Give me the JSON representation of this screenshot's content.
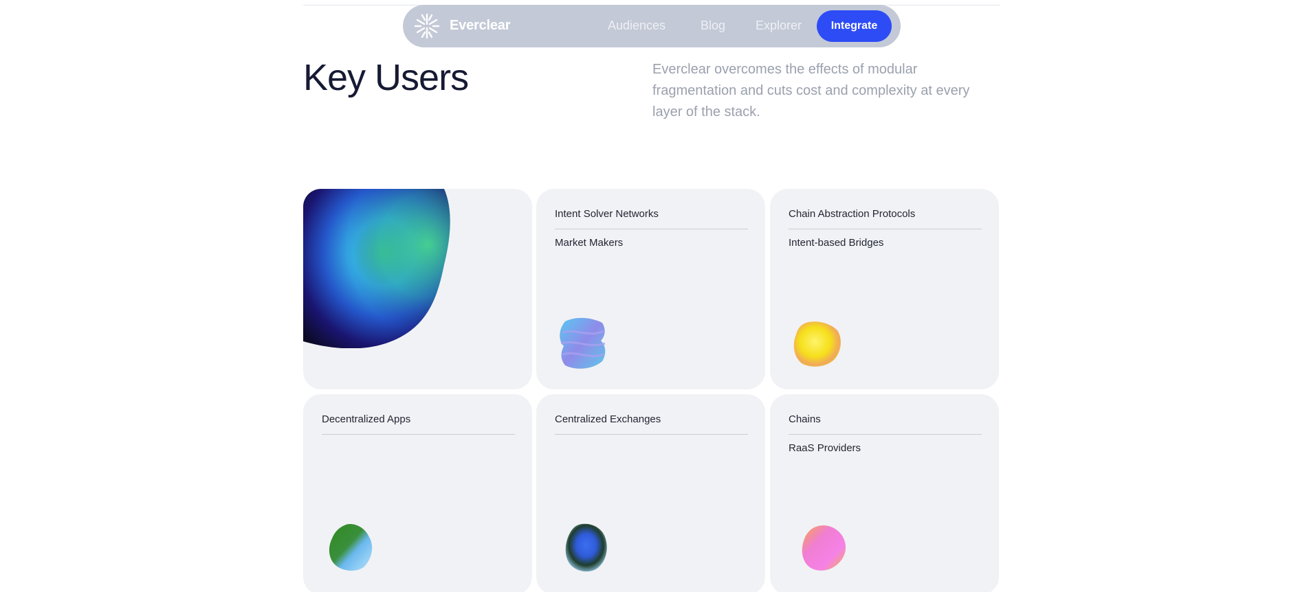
{
  "nav": {
    "brand": "Everclear",
    "links": [
      "Audiences",
      "Blog",
      "Explorer"
    ],
    "cta": "Integrate"
  },
  "hero": {
    "title": "Key Users",
    "description": "Everclear overcomes the effects of modular fragmentation and cuts cost and complexity at every layer of the stack."
  },
  "cards": [
    {
      "items": []
    },
    {
      "items": [
        "Intent Solver Networks",
        "Market Makers"
      ]
    },
    {
      "items": [
        "Chain Abstraction Protocols",
        "Intent-based Bridges"
      ]
    },
    {
      "items": [
        "Decentralized Apps"
      ]
    },
    {
      "items": [
        "Centralized Exchanges"
      ]
    },
    {
      "items": [
        "Chains",
        "RaaS Providers"
      ]
    }
  ],
  "colors": {
    "cta": "#2d4cf6",
    "nav_bg": "#c3c9d6",
    "card_bg": "#f1f2f5",
    "heading": "#161a33"
  }
}
